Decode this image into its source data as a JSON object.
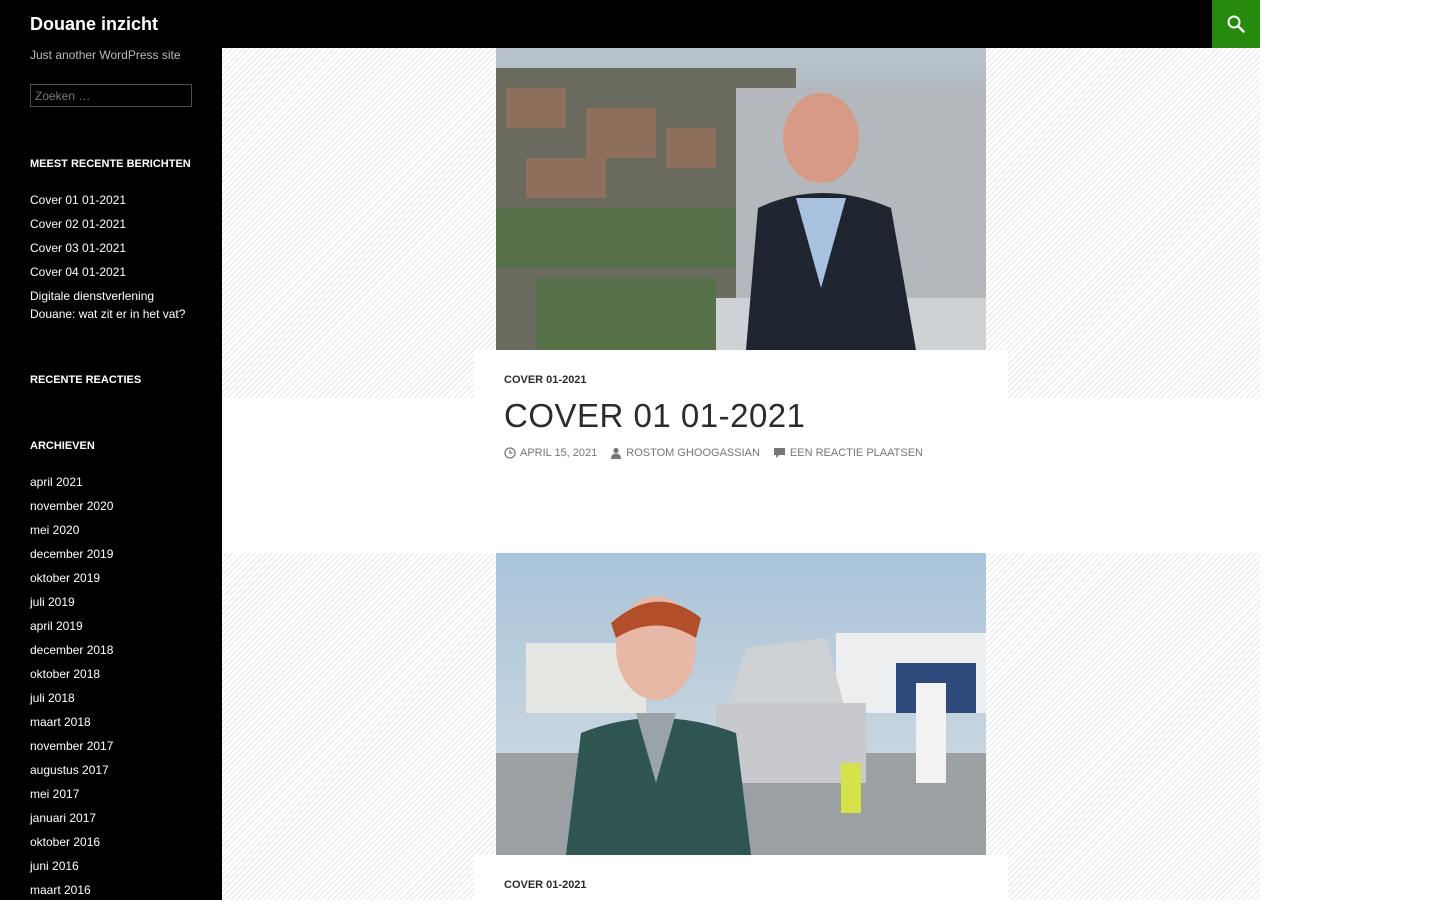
{
  "site": {
    "title": "Douane inzicht",
    "tagline": "Just another WordPress site",
    "accent_color": "#24890d"
  },
  "search": {
    "placeholder": "Zoeken …",
    "value": "",
    "icon": "search-icon"
  },
  "widgets": {
    "recent_posts": {
      "title": "Meest recente berichten",
      "items": [
        "Cover 01 01-2021",
        "Cover 02 01-2021",
        "Cover 03 01-2021",
        "Cover 04 01-2021",
        "Digitale dienstverlening Douane: wat zit er in het vat?"
      ]
    },
    "recent_comments": {
      "title": "Recente reacties"
    },
    "archives": {
      "title": "Archieven",
      "items": [
        "april 2021",
        "november 2020",
        "mei 2020",
        "december 2019",
        "oktober 2019",
        "juli 2019",
        "april 2019",
        "december 2018",
        "oktober 2018",
        "juli 2018",
        "maart 2018",
        "november 2017",
        "augustus 2017",
        "mei 2017",
        "januari 2017",
        "oktober 2016",
        "juni 2016",
        "maart 2016"
      ]
    }
  },
  "posts": [
    {
      "category": "Cover 01-2021",
      "title": "Cover 01 01-2021",
      "date": "April 15, 2021",
      "author": "Rostom Ghoogassian",
      "comments": "Een reactie plaatsen"
    },
    {
      "category": "Cover 01-2021"
    }
  ]
}
